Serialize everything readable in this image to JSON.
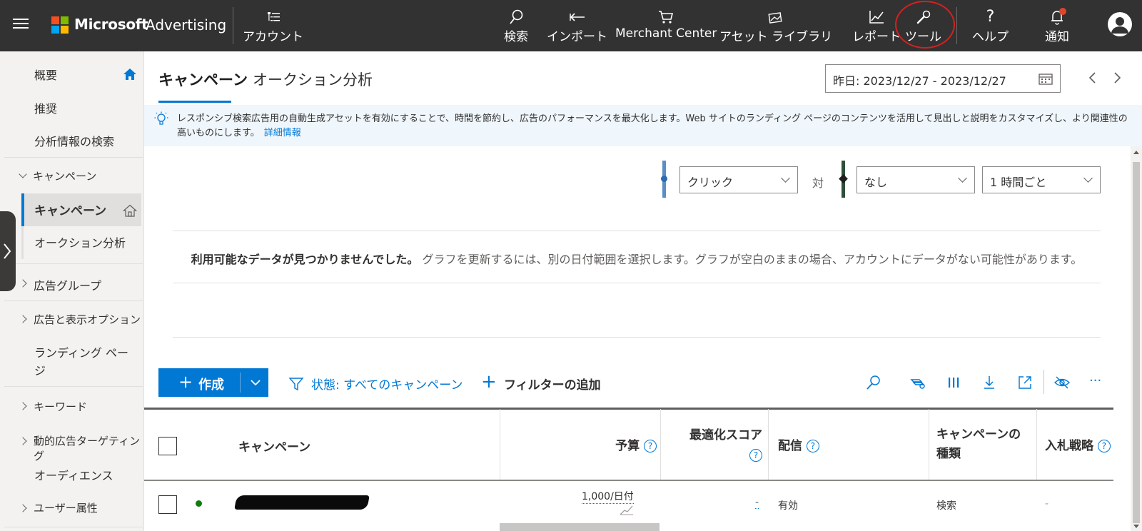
{
  "topbar": {
    "brand_ms": "Microsoft",
    "brand_adv": "Advertising",
    "account_label": "アカウント",
    "nav": {
      "search": "検索",
      "import": "インポート",
      "merchant": "Merchant Center",
      "assets": "アセット ライブラリ",
      "reports": "レポート",
      "tools": "ツール",
      "help": "ヘルプ",
      "notifications": "通知"
    }
  },
  "sidebar": {
    "overview": "概要",
    "recommendations": "推奨",
    "insights": "分析情報の検索",
    "campaigns_group": "キャンペーン",
    "campaigns": "キャンペーン",
    "auction": "オークション分析",
    "adgroups": "広告グループ",
    "ads": "広告と表示オプション",
    "landing": "ランディング ページ",
    "keywords": "キーワード",
    "dsa": "動的広告ターゲティング",
    "audiences": "オーディエンス",
    "demographics": "ユーザー属性"
  },
  "tabs": {
    "campaigns": "キャンペーン",
    "auction": "オークション分析"
  },
  "date_range": "昨日: 2023/12/27 - 2023/12/27",
  "banner": {
    "text": "レスポンシブ検索広告用の自動生成アセットを有効にすることで、時間を節約し、広告のパフォーマンスを最大化します。Web サイトのランディング ページのコンテンツを活用して見出しと説明をカスタマイズし、より関連性の高いものにします。",
    "link": "詳細情報"
  },
  "chart_controls": {
    "metric1": "クリック",
    "vs": "対",
    "metric2": "なし",
    "interval": "1 時間ごと"
  },
  "nodata": {
    "bold": "利用可能なデータが見つかりませんでした。",
    "rest": "グラフを更新するには、別の日付範囲を選択します。グラフが空白のままの場合、アカウントにデータがない可能性があります。"
  },
  "toolbar": {
    "create": "作成",
    "status_filter": "状態: すべてのキャンペーン",
    "add_filter": "フィルターの追加"
  },
  "grid": {
    "headers": {
      "campaign": "キャンペーン",
      "budget": "予算",
      "opt_score": "最適化スコア",
      "delivery": "配信",
      "type": "キャンペーンの種類",
      "bid": "入札戦略"
    },
    "rows": [
      {
        "budget": "1,000/日付",
        "opt_score": "-",
        "delivery": "有効",
        "type": "検索",
        "bid": "-"
      }
    ]
  },
  "colors": {
    "accent": "#0078d4",
    "topbar": "#323232",
    "status_active": "#107c10",
    "tools_circle": "#d42020"
  }
}
